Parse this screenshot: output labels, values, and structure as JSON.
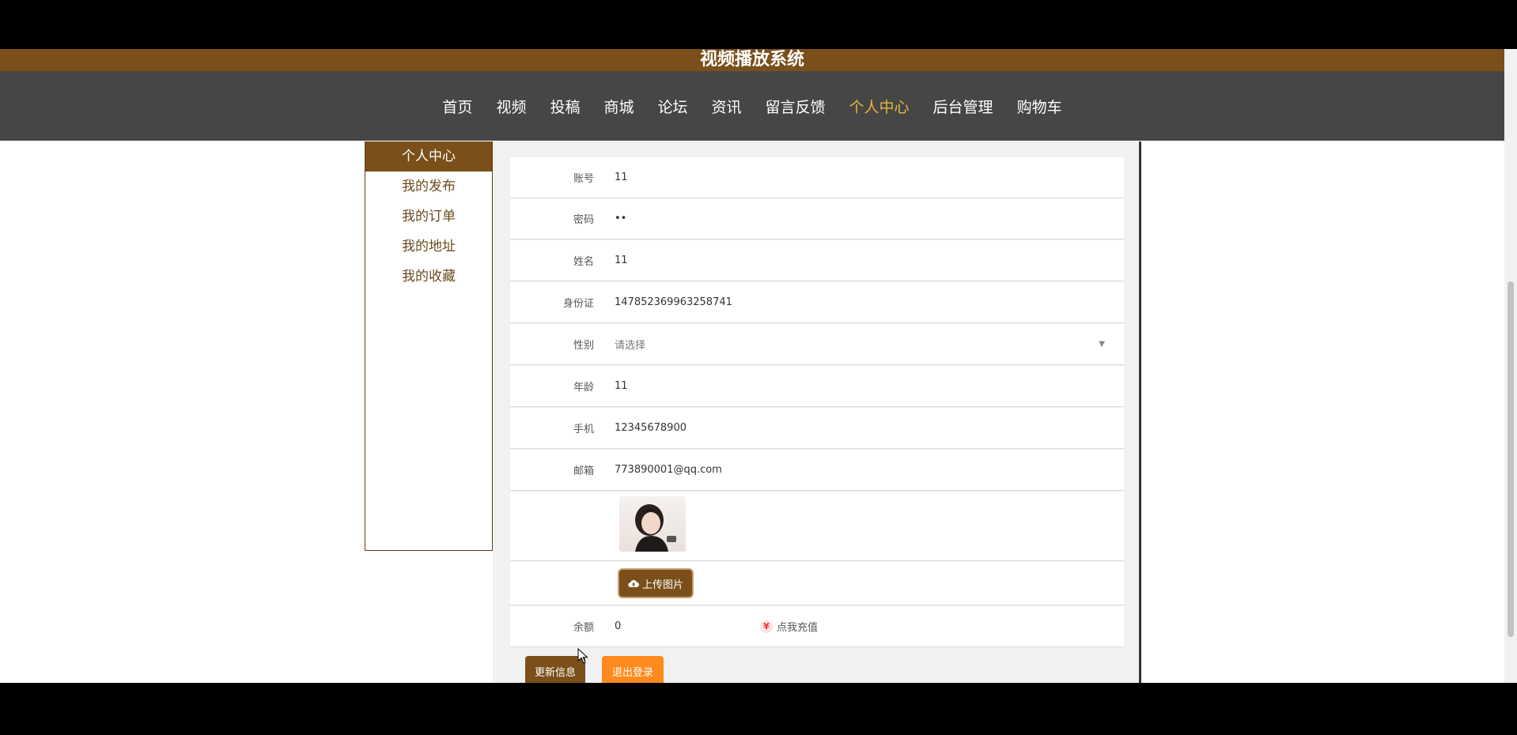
{
  "site_title": "视频播放系统",
  "nav": {
    "items": [
      {
        "label": "首页",
        "active": false
      },
      {
        "label": "视频",
        "active": false
      },
      {
        "label": "投稿",
        "active": false
      },
      {
        "label": "商城",
        "active": false
      },
      {
        "label": "论坛",
        "active": false
      },
      {
        "label": "资讯",
        "active": false
      },
      {
        "label": "留言反馈",
        "active": false
      },
      {
        "label": "个人中心",
        "active": true
      },
      {
        "label": "后台管理",
        "active": false
      },
      {
        "label": "购物车",
        "active": false
      }
    ]
  },
  "sidebar": {
    "items": [
      {
        "label": "个人中心",
        "active": true
      },
      {
        "label": "我的发布",
        "active": false
      },
      {
        "label": "我的订单",
        "active": false
      },
      {
        "label": "我的地址",
        "active": false
      },
      {
        "label": "我的收藏",
        "active": false
      }
    ]
  },
  "form": {
    "account": {
      "label": "账号",
      "value": "11"
    },
    "password": {
      "label": "密码",
      "value": "••"
    },
    "name": {
      "label": "姓名",
      "value": "11"
    },
    "id_card": {
      "label": "身份证",
      "value": "147852369963258741"
    },
    "gender": {
      "label": "性别",
      "value": "请选择"
    },
    "age": {
      "label": "年龄",
      "value": "11"
    },
    "phone": {
      "label": "手机",
      "value": "12345678900"
    },
    "email": {
      "label": "邮箱",
      "value": "773890001@qq.com"
    },
    "upload_label": "上传图片",
    "balance": {
      "label": "余额",
      "value": "0"
    },
    "recharge_label": "点我充值",
    "recharge_icon": "¥"
  },
  "actions": {
    "update_label": "更新信息",
    "logout_label": "退出登录"
  },
  "colors": {
    "brand": "#7a4f1a",
    "nav_bg": "#474646",
    "active_nav": "#e6b73a",
    "logout": "#ff8a1d"
  }
}
